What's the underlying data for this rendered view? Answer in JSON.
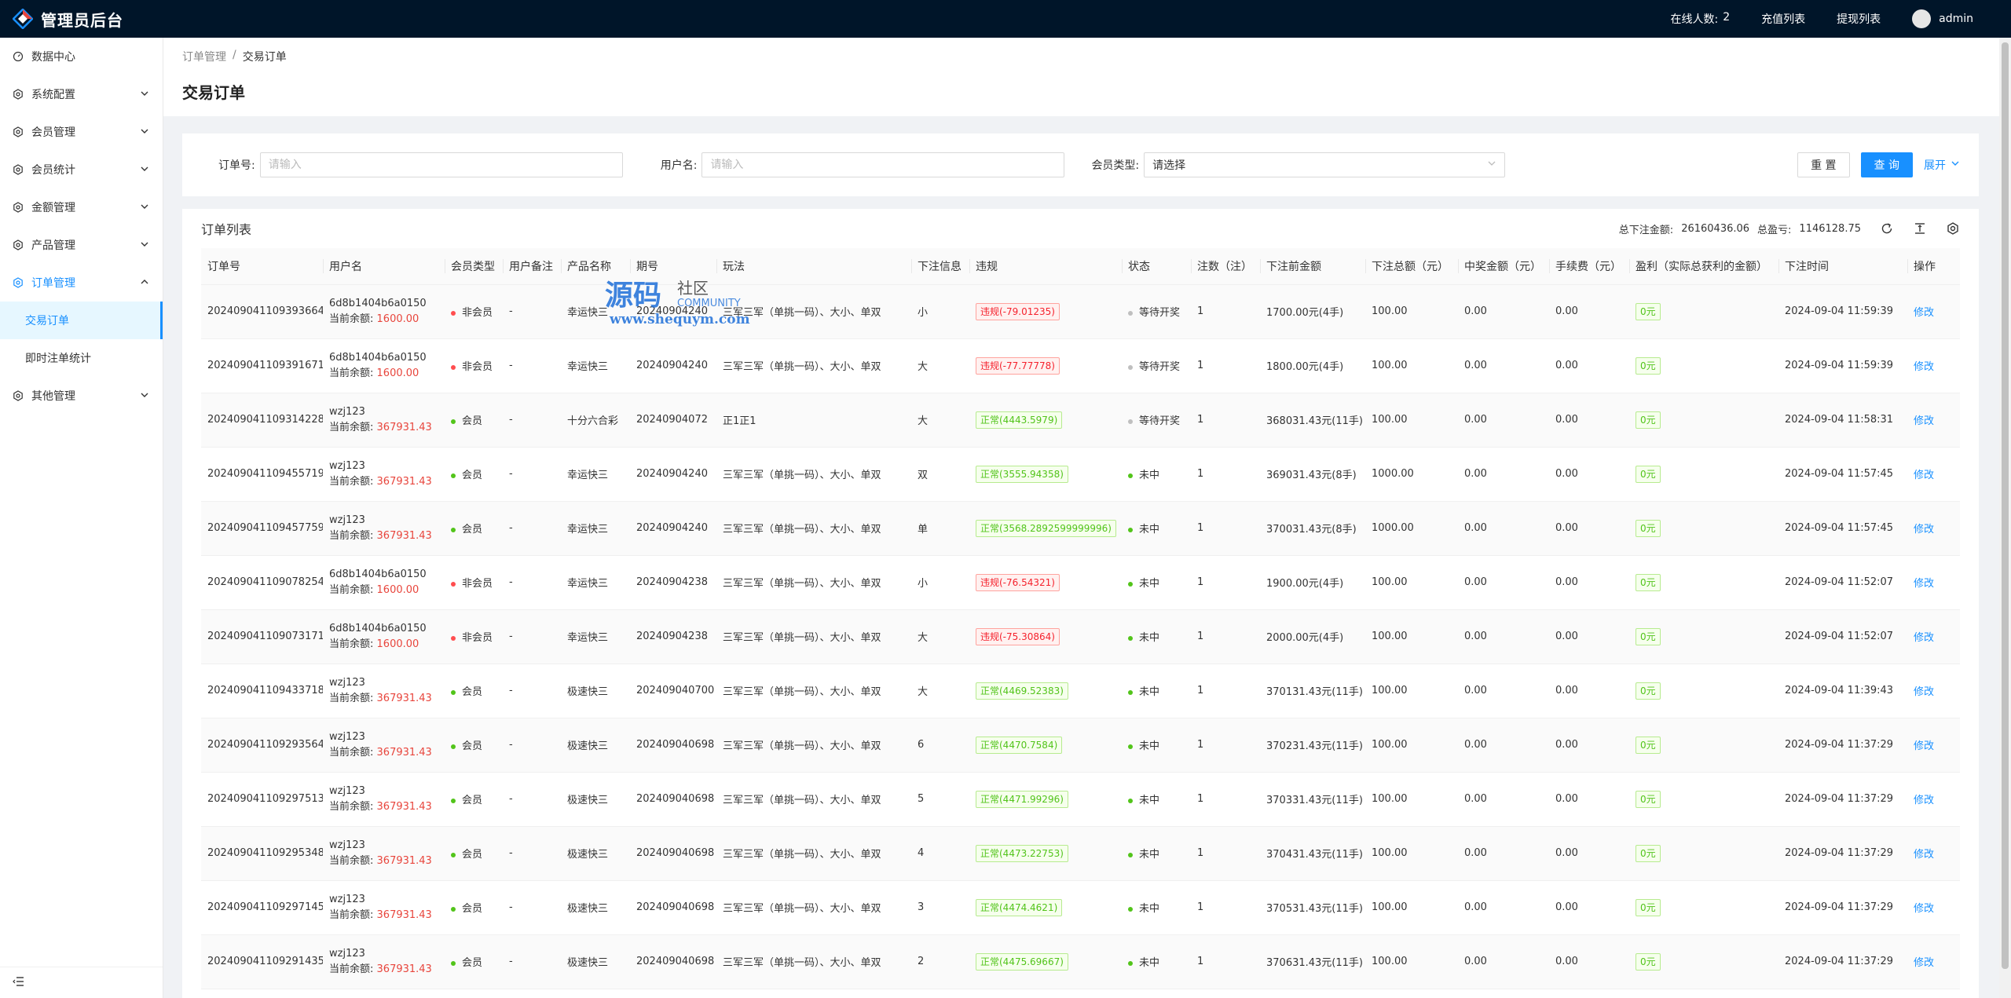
{
  "app": {
    "title": "管理员后台"
  },
  "header": {
    "online_label": "在线人数:",
    "online_count": "2",
    "recharge_list": "充值列表",
    "withdraw_list": "提现列表",
    "username": "admin"
  },
  "sidebar": {
    "items": [
      {
        "label": "数据中心",
        "icon": "dashboard-icon"
      },
      {
        "label": "系统配置",
        "icon": "gear-icon"
      },
      {
        "label": "会员管理",
        "icon": "gear-icon"
      },
      {
        "label": "会员统计",
        "icon": "gear-icon"
      },
      {
        "label": "金额管理",
        "icon": "gear-icon"
      },
      {
        "label": "产品管理",
        "icon": "gear-icon"
      },
      {
        "label": "订单管理",
        "icon": "gear-icon"
      },
      {
        "label": "其他管理",
        "icon": "gear-icon"
      }
    ],
    "sub_items": [
      "交易订单",
      "即时注单统计"
    ]
  },
  "breadcrumb": {
    "parent": "订单管理",
    "separator": "/",
    "current": "交易订单"
  },
  "page_title": "交易订单",
  "search": {
    "order_no_label": "订单号:",
    "order_no_placeholder": "请输入",
    "username_label": "用户名:",
    "username_placeholder": "请输入",
    "member_type_label": "会员类型:",
    "member_type_placeholder": "请选择",
    "reset": "重 置",
    "query": "查 询",
    "expand": "展开"
  },
  "table": {
    "title": "订单列表",
    "total_bet_label": "总下注金额:",
    "total_bet": "26160436.06",
    "total_profit_label": "总盈亏:",
    "total_profit": "1146128.75",
    "columns": [
      "订单号",
      "用户名",
      "会员类型",
      "用户备注",
      "产品名称",
      "期号",
      "玩法",
      "下注信息",
      "违规",
      "状态",
      "注数（注）",
      "下注前金额",
      "下注总额（元）",
      "中奖金额（元）",
      "手续费（元）",
      "盈利（实际总获利的金额）",
      "下注时间",
      "操作"
    ],
    "balance_label": "当前余额:",
    "edit_label": "修改",
    "rows": [
      {
        "order": "202409041109393664",
        "user": "6d8b1404b6a0150",
        "balance": "1600.00",
        "type": "非会员",
        "type_color": "red",
        "remark": "-",
        "product": "幸运快三",
        "period": "20240904240",
        "play": "三军三军（单挑一码）、大小、单双",
        "bet": "小",
        "violation": "违规(-79.01235)",
        "v_kind": "bad",
        "status": "等待开奖",
        "s_color": "grey",
        "count": "1",
        "before": "1700.00元(4手)",
        "total": "100.00",
        "win": "0.00",
        "fee": "0.00",
        "profit": "0元",
        "time": "2024-09-04 11:59:39"
      },
      {
        "order": "202409041109391671",
        "user": "6d8b1404b6a0150",
        "balance": "1600.00",
        "type": "非会员",
        "type_color": "red",
        "remark": "-",
        "product": "幸运快三",
        "period": "20240904240",
        "play": "三军三军（单挑一码）、大小、单双",
        "bet": "大",
        "violation": "违规(-77.77778)",
        "v_kind": "bad",
        "status": "等待开奖",
        "s_color": "grey",
        "count": "1",
        "before": "1800.00元(4手)",
        "total": "100.00",
        "win": "0.00",
        "fee": "0.00",
        "profit": "0元",
        "time": "2024-09-04 11:59:39"
      },
      {
        "order": "202409041109314228",
        "user": "wzj123",
        "balance": "367931.43",
        "type": "会员",
        "type_color": "green",
        "remark": "-",
        "product": "十分六合彩",
        "period": "20240904072",
        "play": "正1正1",
        "bet": "大",
        "violation": "正常(4443.5979)",
        "v_kind": "good",
        "status": "等待开奖",
        "s_color": "grey",
        "count": "1",
        "before": "368031.43元(11手)",
        "total": "100.00",
        "win": "0.00",
        "fee": "0.00",
        "profit": "0元",
        "time": "2024-09-04 11:58:31"
      },
      {
        "order": "202409041109455719",
        "user": "wzj123",
        "balance": "367931.43",
        "type": "会员",
        "type_color": "green",
        "remark": "-",
        "product": "幸运快三",
        "period": "20240904240",
        "play": "三军三军（单挑一码）、大小、单双",
        "bet": "双",
        "violation": "正常(3555.94358)",
        "v_kind": "good",
        "status": "未中",
        "s_color": "green",
        "count": "1",
        "before": "369031.43元(8手)",
        "total": "1000.00",
        "win": "0.00",
        "fee": "0.00",
        "profit": "0元",
        "time": "2024-09-04 11:57:45"
      },
      {
        "order": "202409041109457759",
        "user": "wzj123",
        "balance": "367931.43",
        "type": "会员",
        "type_color": "green",
        "remark": "-",
        "product": "幸运快三",
        "period": "20240904240",
        "play": "三军三军（单挑一码）、大小、单双",
        "bet": "单",
        "violation": "正常(3568.2892599999996)",
        "v_kind": "good",
        "status": "未中",
        "s_color": "green",
        "count": "1",
        "before": "370031.43元(8手)",
        "total": "1000.00",
        "win": "0.00",
        "fee": "0.00",
        "profit": "0元",
        "time": "2024-09-04 11:57:45"
      },
      {
        "order": "202409041109078254",
        "user": "6d8b1404b6a0150",
        "balance": "1600.00",
        "type": "非会员",
        "type_color": "red",
        "remark": "-",
        "product": "幸运快三",
        "period": "20240904238",
        "play": "三军三军（单挑一码）、大小、单双",
        "bet": "小",
        "violation": "违规(-76.54321)",
        "v_kind": "bad",
        "status": "未中",
        "s_color": "green",
        "count": "1",
        "before": "1900.00元(4手)",
        "total": "100.00",
        "win": "0.00",
        "fee": "0.00",
        "profit": "0元",
        "time": "2024-09-04 11:52:07"
      },
      {
        "order": "202409041109073171",
        "user": "6d8b1404b6a0150",
        "balance": "1600.00",
        "type": "非会员",
        "type_color": "red",
        "remark": "-",
        "product": "幸运快三",
        "period": "20240904238",
        "play": "三军三军（单挑一码）、大小、单双",
        "bet": "大",
        "violation": "违规(-75.30864)",
        "v_kind": "bad",
        "status": "未中",
        "s_color": "green",
        "count": "1",
        "before": "2000.00元(4手)",
        "total": "100.00",
        "win": "0.00",
        "fee": "0.00",
        "profit": "0元",
        "time": "2024-09-04 11:52:07"
      },
      {
        "order": "202409041109433718",
        "user": "wzj123",
        "balance": "367931.43",
        "type": "会员",
        "type_color": "green",
        "remark": "-",
        "product": "极速快三",
        "period": "202409040700",
        "play": "三军三军（单挑一码）、大小、单双",
        "bet": "大",
        "violation": "正常(4469.52383)",
        "v_kind": "good",
        "status": "未中",
        "s_color": "green",
        "count": "1",
        "before": "370131.43元(11手)",
        "total": "100.00",
        "win": "0.00",
        "fee": "0.00",
        "profit": "0元",
        "time": "2024-09-04 11:39:43"
      },
      {
        "order": "202409041109293564",
        "user": "wzj123",
        "balance": "367931.43",
        "type": "会员",
        "type_color": "green",
        "remark": "-",
        "product": "极速快三",
        "period": "202409040698",
        "play": "三军三军（单挑一码）、大小、单双",
        "bet": "6",
        "violation": "正常(4470.7584)",
        "v_kind": "good",
        "status": "未中",
        "s_color": "green",
        "count": "1",
        "before": "370231.43元(11手)",
        "total": "100.00",
        "win": "0.00",
        "fee": "0.00",
        "profit": "0元",
        "time": "2024-09-04 11:37:29"
      },
      {
        "order": "202409041109297513",
        "user": "wzj123",
        "balance": "367931.43",
        "type": "会员",
        "type_color": "green",
        "remark": "-",
        "product": "极速快三",
        "period": "202409040698",
        "play": "三军三军（单挑一码）、大小、单双",
        "bet": "5",
        "violation": "正常(4471.99296)",
        "v_kind": "good",
        "status": "未中",
        "s_color": "green",
        "count": "1",
        "before": "370331.43元(11手)",
        "total": "100.00",
        "win": "0.00",
        "fee": "0.00",
        "profit": "0元",
        "time": "2024-09-04 11:37:29"
      },
      {
        "order": "202409041109295348",
        "user": "wzj123",
        "balance": "367931.43",
        "type": "会员",
        "type_color": "green",
        "remark": "-",
        "product": "极速快三",
        "period": "202409040698",
        "play": "三军三军（单挑一码）、大小、单双",
        "bet": "4",
        "violation": "正常(4473.22753)",
        "v_kind": "good",
        "status": "未中",
        "s_color": "green",
        "count": "1",
        "before": "370431.43元(11手)",
        "total": "100.00",
        "win": "0.00",
        "fee": "0.00",
        "profit": "0元",
        "time": "2024-09-04 11:37:29"
      },
      {
        "order": "202409041109297145",
        "user": "wzj123",
        "balance": "367931.43",
        "type": "会员",
        "type_color": "green",
        "remark": "-",
        "product": "极速快三",
        "period": "202409040698",
        "play": "三军三军（单挑一码）、大小、单双",
        "bet": "3",
        "violation": "正常(4474.4621)",
        "v_kind": "good",
        "status": "未中",
        "s_color": "green",
        "count": "1",
        "before": "370531.43元(11手)",
        "total": "100.00",
        "win": "0.00",
        "fee": "0.00",
        "profit": "0元",
        "time": "2024-09-04 11:37:29"
      },
      {
        "order": "202409041109291435",
        "user": "wzj123",
        "balance": "367931.43",
        "type": "会员",
        "type_color": "green",
        "remark": "-",
        "product": "极速快三",
        "period": "202409040698",
        "play": "三军三军（单挑一码）、大小、单双",
        "bet": "2",
        "violation": "正常(4475.69667)",
        "v_kind": "good",
        "status": "未中",
        "s_color": "green",
        "count": "1",
        "before": "370631.43元(11手)",
        "total": "100.00",
        "win": "0.00",
        "fee": "0.00",
        "profit": "0元",
        "time": "2024-09-04 11:37:29"
      },
      {
        "order": "",
        "user": "",
        "balance": "",
        "type": "",
        "type_color": "",
        "remark": "",
        "product": "",
        "period": "",
        "play": "",
        "bet": "",
        "violation": "",
        "v_kind": "",
        "status": "",
        "s_color": "",
        "count": "",
        "before": "",
        "total": "",
        "win": "",
        "fee": "",
        "profit": "",
        "time": ""
      }
    ]
  },
  "watermark": {
    "line1": "源码",
    "line2": "社区",
    "line3": "COMMUNITY",
    "url": "www.shequym.com"
  },
  "colors": {
    "header_bg": "#001529",
    "primary": "#1890ff",
    "danger": "#e8453c",
    "success": "#52c41a"
  }
}
